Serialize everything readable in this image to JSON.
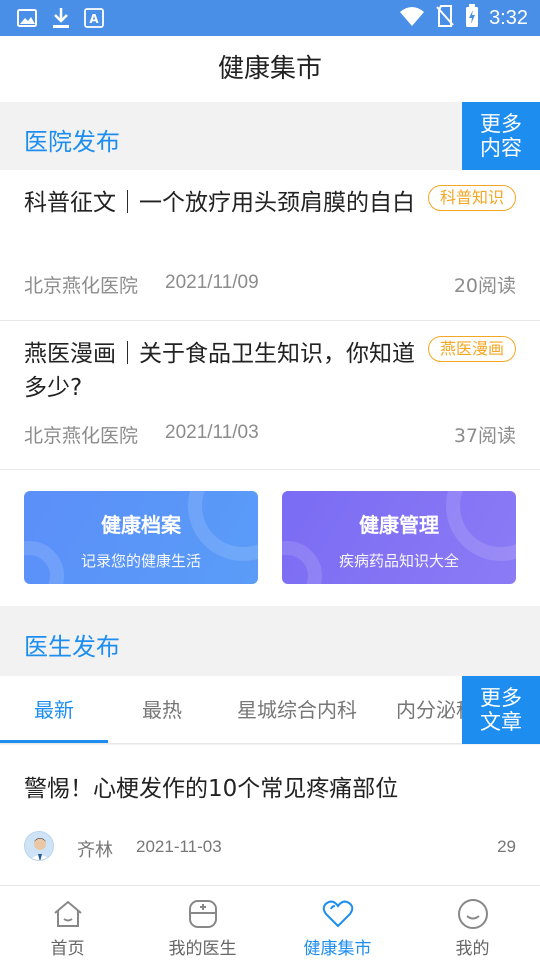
{
  "status_bar": {
    "time": "3:32",
    "icons": [
      "image-icon",
      "download-icon",
      "font-icon",
      "wifi-icon",
      "no-sim-icon",
      "battery-charging-icon"
    ]
  },
  "header": {
    "title": "健康集市"
  },
  "hospital_section": {
    "title": "医院发布",
    "more_label_line1": "更多",
    "more_label_line2": "内容",
    "articles": [
      {
        "title": "科普征文｜一个放疗用头颈肩膜的自白",
        "tag": "科普知识",
        "source": "北京燕化医院",
        "date": "2021/11/09",
        "reads": "20阅读"
      },
      {
        "title": "燕医漫画｜关于食品卫生知识，你知道多少?",
        "tag": "燕医漫画",
        "source": "北京燕化医院",
        "date": "2021/11/03",
        "reads": "37阅读"
      }
    ]
  },
  "cards": [
    {
      "title": "健康档案",
      "subtitle": "记录您的健康生活",
      "color": "#5b8ff9"
    },
    {
      "title": "健康管理",
      "subtitle": "疾病药品知识大全",
      "color": "#7a6cf4"
    }
  ],
  "doctor_section": {
    "title": "医生发布",
    "more_label_line1": "更多",
    "more_label_line2": "文章",
    "tabs": [
      "最新",
      "最热",
      "星城综合内科",
      "内分泌科"
    ],
    "active_tab": 0,
    "post": {
      "title": "警惕！心梗发作的10个常见疼痛部位",
      "author": "齐林",
      "date": "2021-11-03",
      "count": "29"
    }
  },
  "bottom_nav": {
    "items": [
      {
        "label": "首页",
        "icon": "home-icon"
      },
      {
        "label": "我的医生",
        "icon": "doctor-bag-icon"
      },
      {
        "label": "健康集市",
        "icon": "heart-icon"
      },
      {
        "label": "我的",
        "icon": "smile-icon"
      }
    ],
    "active_index": 2
  },
  "colors": {
    "accent": "#1d8ef0",
    "status_bar": "#4a8fe7",
    "tag": "#f5a623"
  }
}
